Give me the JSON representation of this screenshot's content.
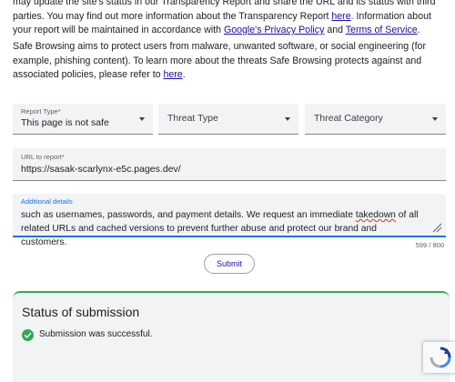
{
  "intro": {
    "p1_pre": "may update the site's status in our Transparency Report and share the URL and its status with third parties. You may find out more information about the Transparency Report ",
    "p1_link1": "here",
    "p1_mid": ". Information about your report will be maintained in accordance with ",
    "p1_link2": "Google's Privacy Policy",
    "p1_and": " and ",
    "p1_link3": "Terms of Service",
    "p1_end": ".",
    "p2_pre": "Safe Browsing aims to protect users from malware, unwanted software, or social engineering (for example, phishing content). To learn more about the threats Safe Browsing protects against and associated policies, please refer to ",
    "p2_link": "here",
    "p2_end": "."
  },
  "form": {
    "report_type": {
      "label": "Report Type*",
      "value": "This page is not safe"
    },
    "threat_type": {
      "placeholder": "Threat Type"
    },
    "threat_category": {
      "placeholder": "Threat Category"
    },
    "url": {
      "label": "URL to report*",
      "value": "https://sasak-scarlynx-e5c.pages.dev/"
    },
    "details": {
      "label": "Additional details",
      "text_before": "such as usernames, passwords, and payment details. We request an immediate ",
      "text_misspelled": "takedown",
      "text_after": " of all related URLs and cached versions to prevent further abuse and protect our brand and customers.",
      "counter": "599 / 800"
    },
    "submit_label": "Submit"
  },
  "status": {
    "title": "Status of submission",
    "message": "Submission was successful."
  },
  "icons": {
    "success": "check-circle-icon",
    "recaptcha": "recaptcha-icon",
    "dropdown": "caret-down-icon"
  },
  "colors": {
    "success_green": "#34a853",
    "link": "#1a0dab",
    "focus_blue": "#1a73e8"
  }
}
